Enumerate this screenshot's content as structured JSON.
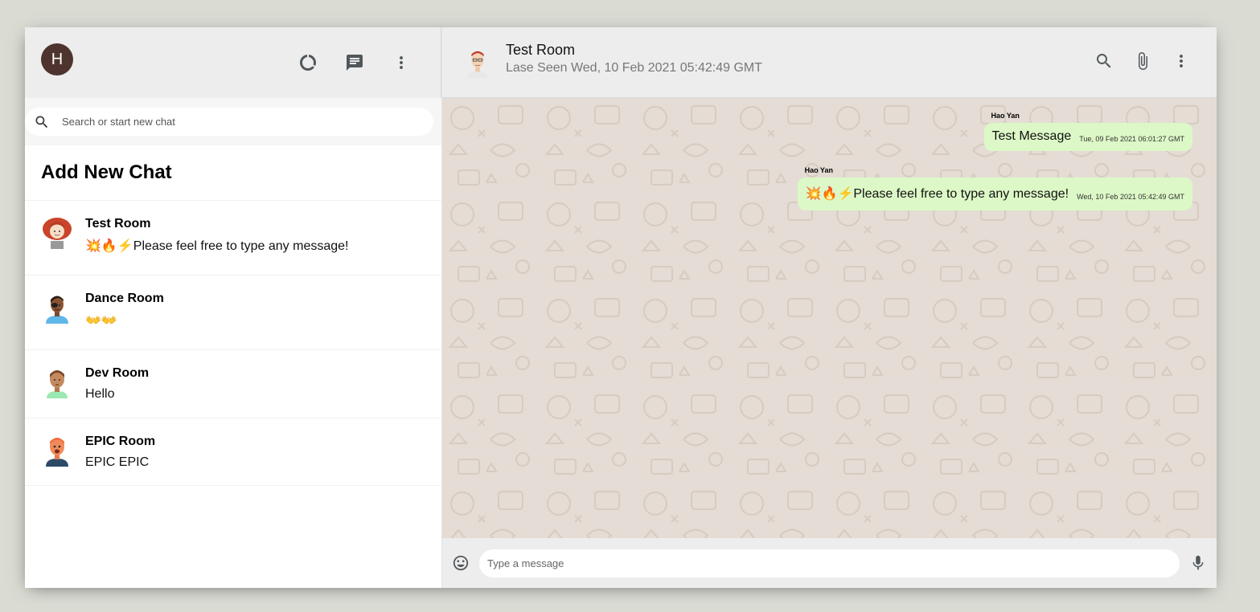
{
  "user": {
    "initial": "H"
  },
  "search": {
    "placeholder": "Search or start new chat"
  },
  "sidebar": {
    "add_new": "Add New Chat",
    "chats": [
      {
        "name": "Test Room",
        "last": "💥🔥⚡️Please feel free to type any message!"
      },
      {
        "name": "Dance Room",
        "last": "👐👐"
      },
      {
        "name": "Dev Room",
        "last": "Hello"
      },
      {
        "name": "EPIC Room",
        "last": "EPIC EPIC"
      }
    ]
  },
  "chat": {
    "title": "Test Room",
    "last_seen": "Lase Seen Wed, 10 Feb 2021 05:42:49 GMT",
    "messages": [
      {
        "name": "Hao Yan",
        "text": "Test Message",
        "time": "Tue, 09 Feb 2021 06:01:27 GMT"
      },
      {
        "name": "Hao Yan",
        "text": "💥🔥⚡️Please feel free to type any message!",
        "time": "Wed, 10 Feb 2021 05:42:49 GMT"
      }
    ],
    "input_placeholder": "Type a message"
  },
  "colors": {
    "bubble": "#dcf8c6",
    "background": "#e5ddd5",
    "header": "#ededed"
  }
}
